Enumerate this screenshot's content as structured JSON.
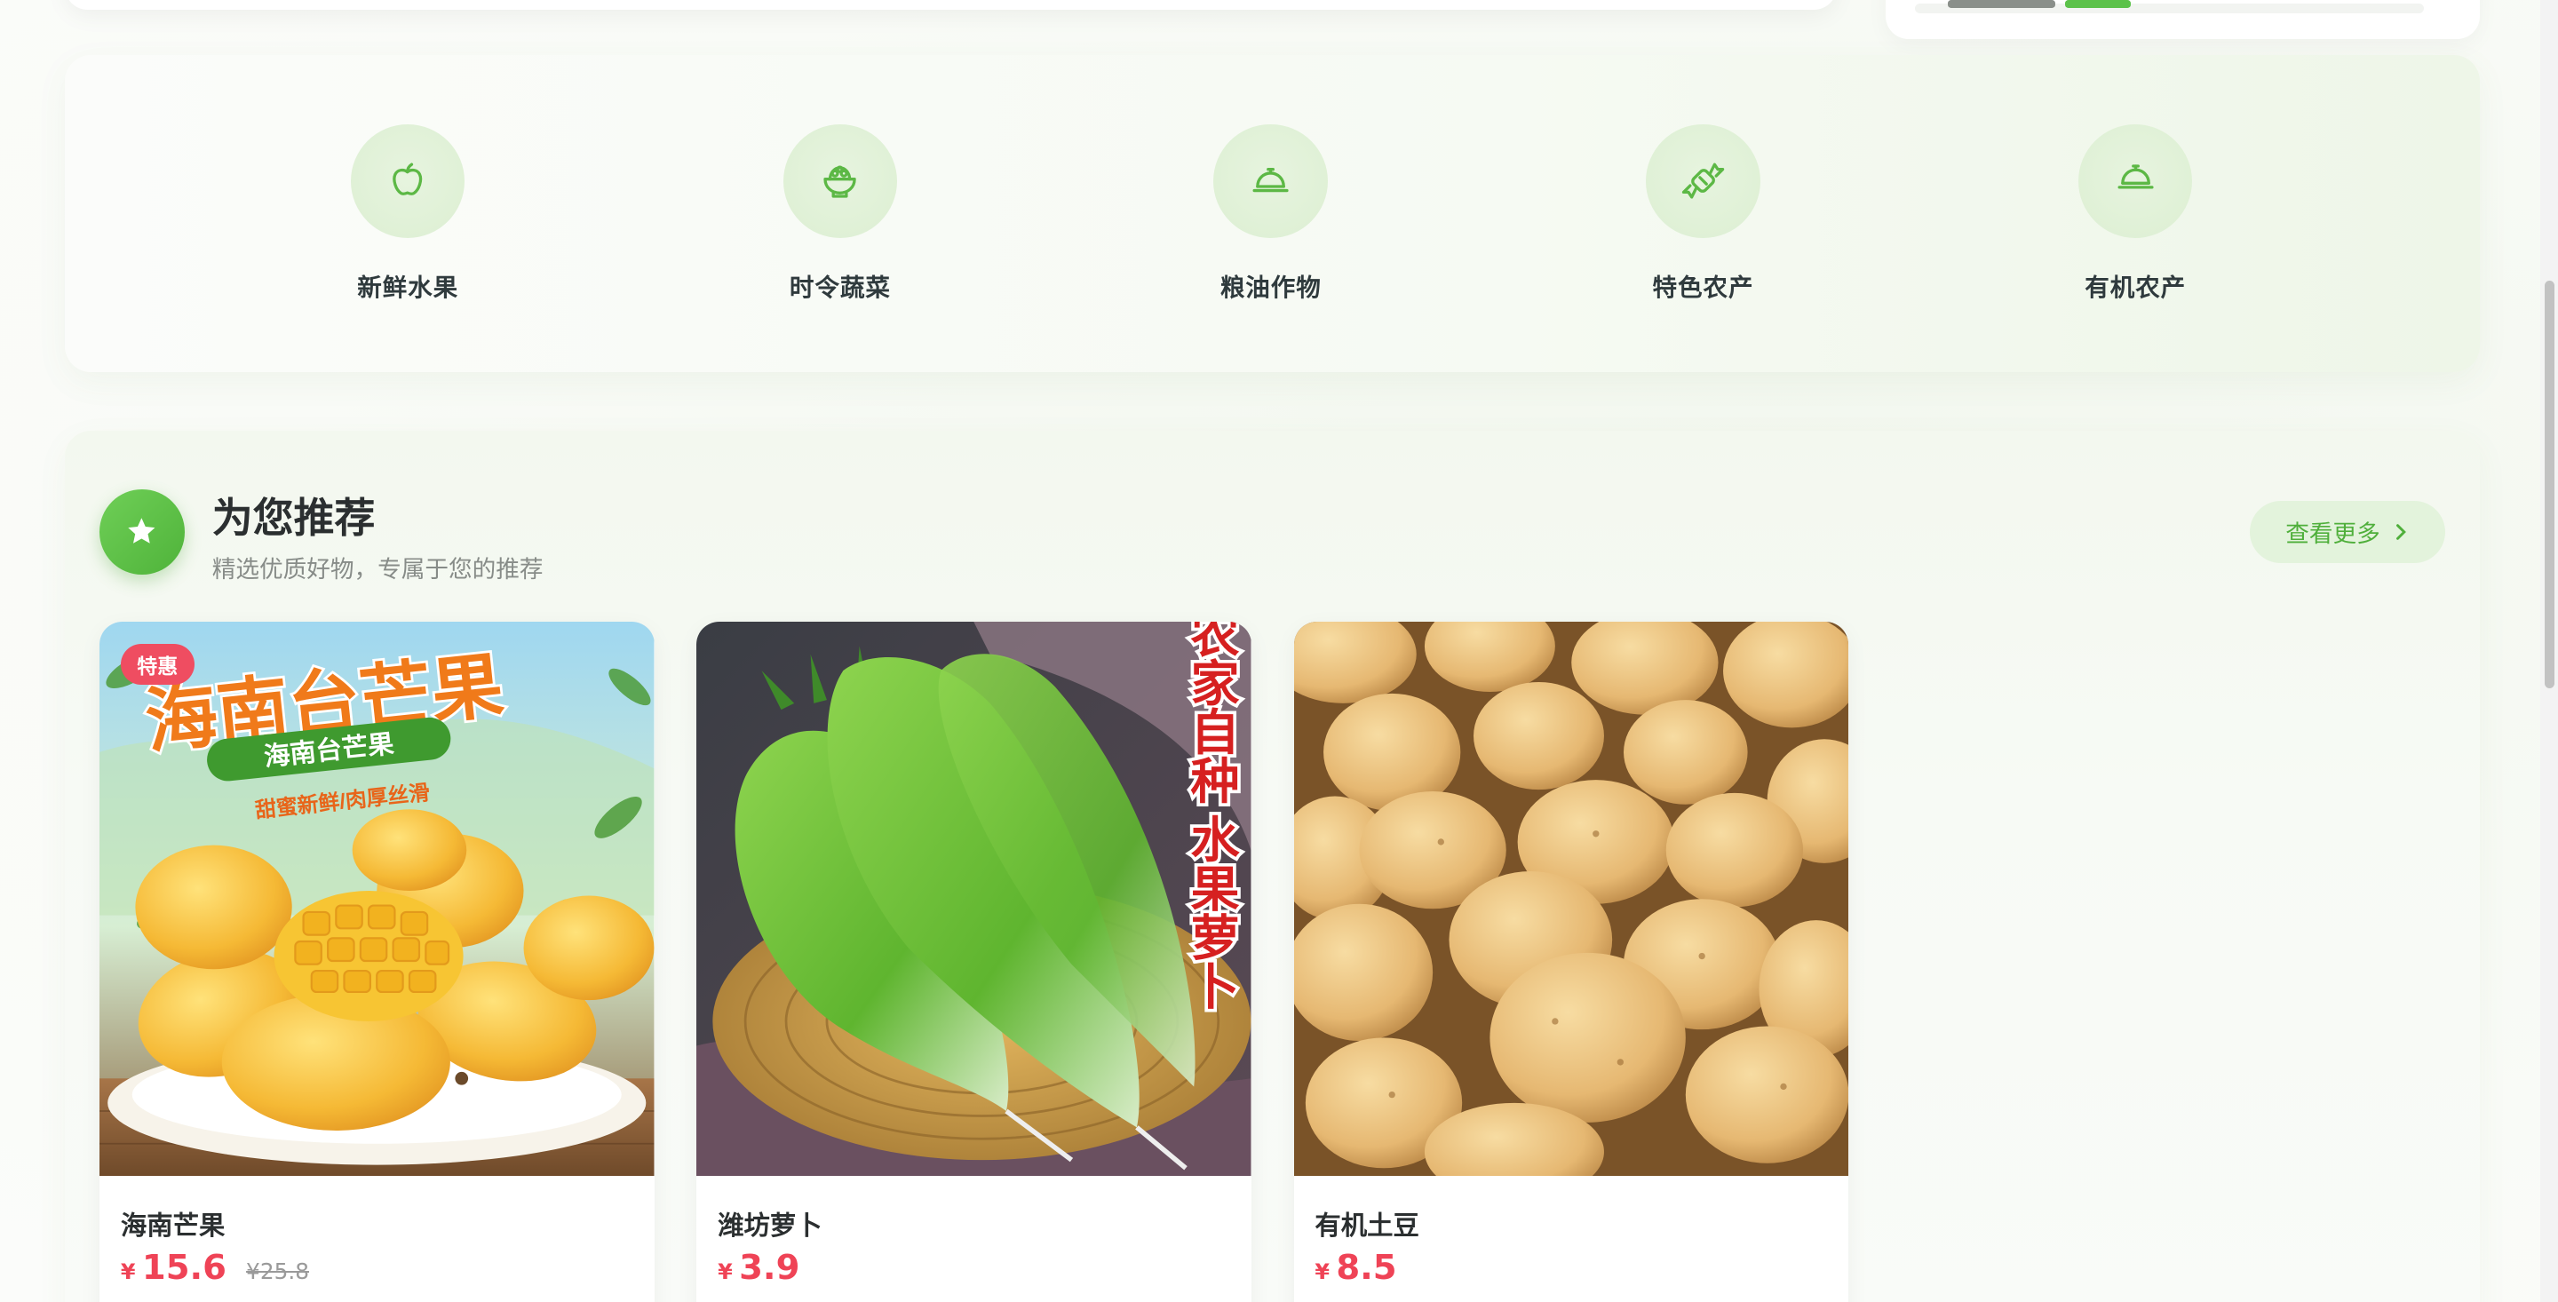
{
  "categories": [
    {
      "label": "新鲜水果",
      "icon": "apple-icon"
    },
    {
      "label": "时令蔬菜",
      "icon": "bowl-icon"
    },
    {
      "label": "粮油作物",
      "icon": "dish-icon"
    },
    {
      "label": "特色农产",
      "icon": "candy-icon"
    },
    {
      "label": "有机农产",
      "icon": "dish-icon"
    }
  ],
  "recommend": {
    "title": "为您推荐",
    "subtitle": "精选优质好物，专属于您的推荐",
    "more_label": "查看更多"
  },
  "products": [
    {
      "name": "海南芒果",
      "currency": "¥",
      "price": "15.6",
      "old_price": "¥25.8",
      "badge": "特惠",
      "image_text": {
        "headline": "海南台芒果",
        "banner": "海南台芒果",
        "slogan": "甜蜜新鲜/肉厚丝滑"
      }
    },
    {
      "name": "潍坊萝卜",
      "currency": "¥",
      "price": "3.9",
      "image_text": {
        "vertical_a": "农家自种",
        "vertical_b": "水果萝卜"
      }
    },
    {
      "name": "有机土豆",
      "currency": "¥",
      "price": "8.5"
    }
  ],
  "colors": {
    "accent": "#4faf3b",
    "price": "#ef4356",
    "badge": "#ef4d61"
  }
}
